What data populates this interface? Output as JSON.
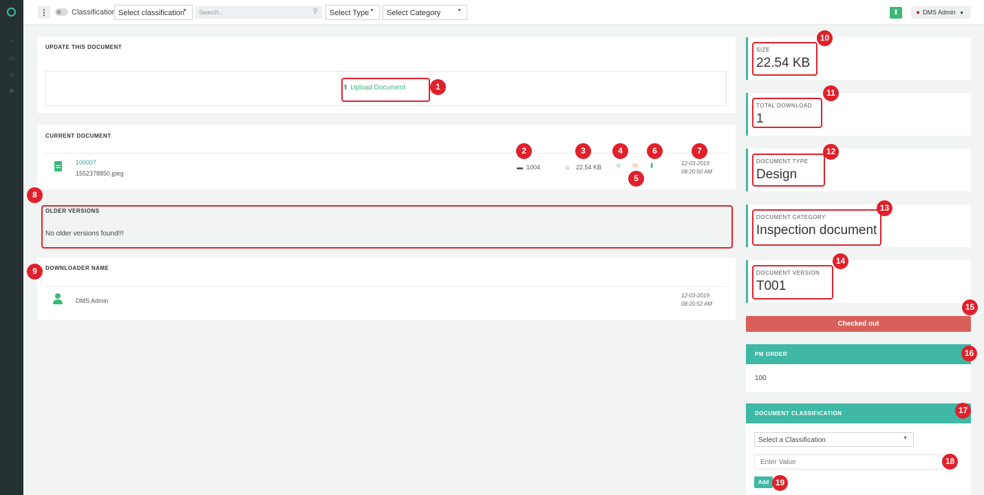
{
  "topbar": {
    "menu_icon": "kebab-icon",
    "classification_label": "Classification",
    "classification_select": "Select classification",
    "search_placeholder": "Search..",
    "type_select": "Select Type",
    "category_select": "Select Category",
    "user_name": "DMS Admin"
  },
  "update_panel": {
    "title": "UPDATE THIS DOCUMENT",
    "upload_label": "Upload Document"
  },
  "current_document": {
    "title": "CURRENT DOCUMENT",
    "doc_id": "100007",
    "filename": "1552378850.jpeg",
    "number": "1004",
    "size": "22.54 KB",
    "date": "12-03-2019",
    "time": "08:20:50 AM"
  },
  "older_versions": {
    "title": "OLDER VERSIONS",
    "empty_text": "No older versions found!!!"
  },
  "downloader": {
    "title": "DOWNLOADER NAME",
    "name": "DMS Admin",
    "date": "12-03-2019",
    "time": "08:20:52 AM"
  },
  "stats": {
    "size": {
      "label": "SIZE",
      "value": "22.54 KB"
    },
    "total_download": {
      "label": "TOTAL DOWNLOAD",
      "value": "1"
    },
    "document_type": {
      "label": "DOCUMENT TYPE",
      "value": "Design"
    },
    "document_category": {
      "label": "DOCUMENT CATEGORY",
      "value": "Inspection document"
    },
    "document_version": {
      "label": "DOCUMENT VERSION",
      "value": "T001"
    }
  },
  "status_button": "Checked out",
  "pm_order": {
    "title": "PM ORDER",
    "value": "100"
  },
  "document_classification": {
    "title": "DOCUMENT CLASSIFICATION",
    "select": "Select a Classification",
    "input_placeholder": "Enter Value",
    "add_label": "Add"
  },
  "annotations": [
    "1",
    "2",
    "3",
    "4",
    "5",
    "6",
    "7",
    "8",
    "9",
    "10",
    "11",
    "12",
    "13",
    "14",
    "15",
    "16",
    "17",
    "18",
    "19"
  ],
  "colors": {
    "accent": "#3fb8a5",
    "success": "#3cb878",
    "danger": "#d9605a",
    "highlight": "#e0202a",
    "sidebar": "#263133"
  }
}
